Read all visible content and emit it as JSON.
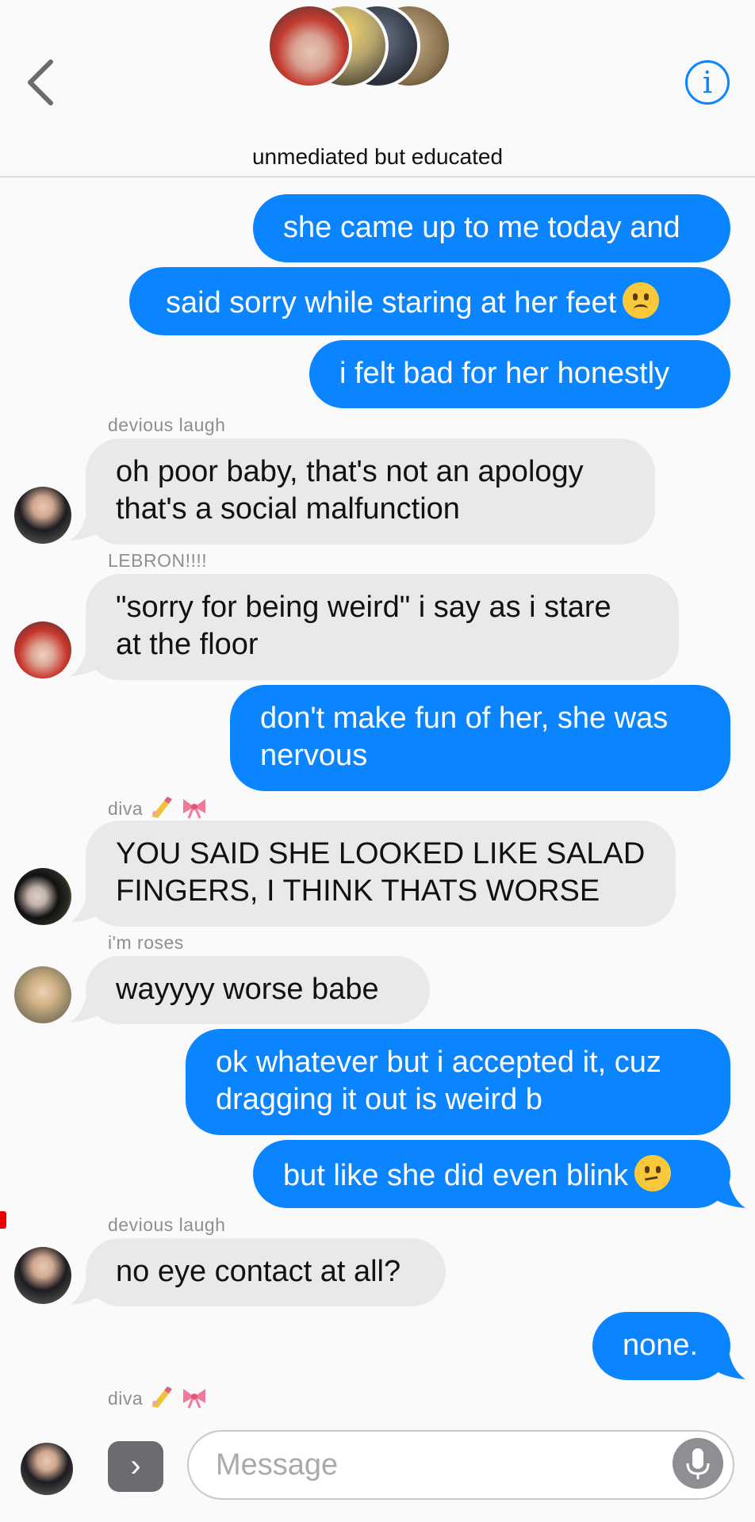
{
  "header": {
    "group_name": "unmediated but educated",
    "back_icon": "chevron-left-icon",
    "info_icon": "info-circle-icon",
    "info_glyph": "i",
    "accent_color": "#0a84ff"
  },
  "messages": [
    {
      "side": "sent",
      "text": "she came up to me today and"
    },
    {
      "side": "sent",
      "text": "said sorry while staring at her feet",
      "emoji": "slightly-frowning-face"
    },
    {
      "side": "sent",
      "text": "i felt bad for her honestly"
    },
    {
      "side": "recv",
      "sender": "devious laugh",
      "lines": [
        "oh poor baby, that's not an apology",
        "that's a social malfunction"
      ]
    },
    {
      "side": "recv",
      "sender": "LEBRON!!!!",
      "lines": [
        "\"sorry for being weird\" i say as i stare",
        "at the floor"
      ]
    },
    {
      "side": "sent",
      "lines": [
        "don't make fun of her, she was",
        "nervous"
      ]
    },
    {
      "side": "recv",
      "sender": "diva",
      "sender_emoji": [
        "nail-polish",
        "ribbon"
      ],
      "lines": [
        "YOU SAID SHE LOOKED LIKE SALAD",
        "FINGERS, I THINK THATS WORSE"
      ]
    },
    {
      "side": "recv",
      "sender": "i'm roses",
      "text": "wayyyy worse babe"
    },
    {
      "side": "sent",
      "lines": [
        "ok whatever but i accepted it, cuz",
        "dragging it out is weird b"
      ]
    },
    {
      "side": "sent",
      "text": "but like she did even blink",
      "emoji": "confused-face"
    },
    {
      "side": "recv",
      "sender": "devious laugh",
      "text": "no eye contact at all?"
    },
    {
      "side": "sent",
      "text": "none."
    },
    {
      "side": "recv",
      "sender": "diva",
      "sender_emoji": [
        "nail-polish",
        "ribbon"
      ]
    }
  ],
  "composer": {
    "placeholder": "Message",
    "apps_glyph": "›",
    "apps_icon": "chevron-right-icon",
    "mic_icon": "microphone-icon"
  },
  "colors": {
    "sent_bubble": "#0a84ff",
    "received_bubble": "#e9e9eb",
    "sender_label": "#8e8e93"
  }
}
